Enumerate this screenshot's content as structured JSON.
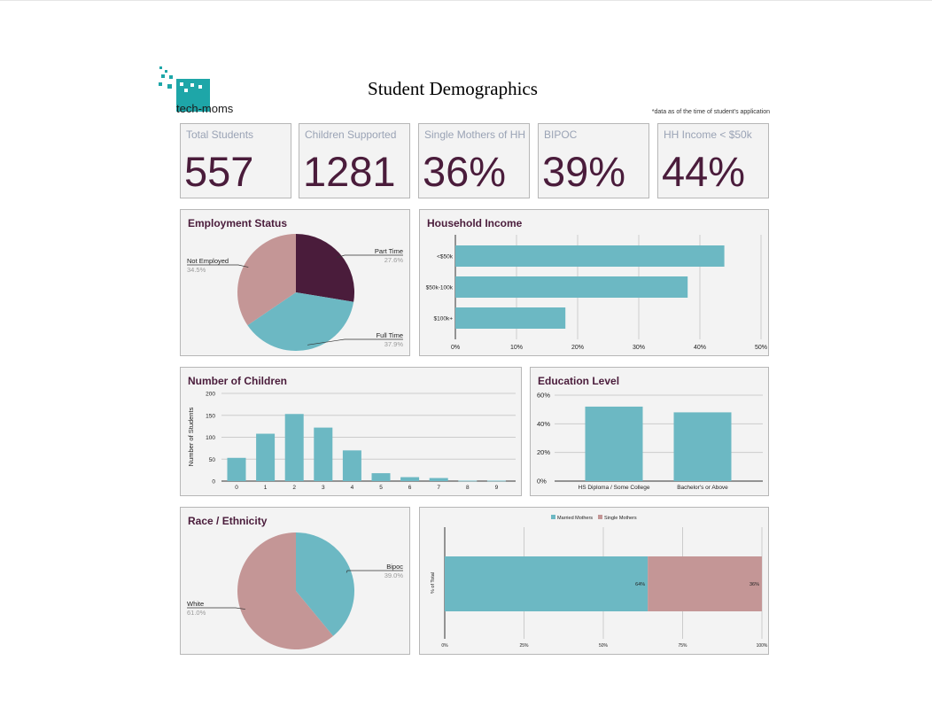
{
  "header": {
    "logo_text": "tech-moms",
    "title": "Student Demographics",
    "note": "*data as of the time of student's application"
  },
  "kpis": [
    {
      "label": "Total Students",
      "value": "557"
    },
    {
      "label": "Children Supported",
      "value": "1281"
    },
    {
      "label": "Single Mothers of HH",
      "value": "36%"
    },
    {
      "label": "BIPOC",
      "value": "39%"
    },
    {
      "label": "HH Income < $50k",
      "value": "44%"
    }
  ],
  "colors": {
    "dark": "#4a1c3b",
    "teal": "#6cb8c3",
    "rose": "#c49696",
    "panel": "#f3f3f3",
    "grid": "#cccccc"
  },
  "chart_data": [
    {
      "type": "pie",
      "title": "Employment Status",
      "slices": [
        {
          "label": "Part Time",
          "pct": "27.6%",
          "value": 27.6,
          "color": "#4a1c3b"
        },
        {
          "label": "Full Time",
          "pct": "37.9%",
          "value": 37.9,
          "color": "#6cb8c3"
        },
        {
          "label": "Not Employed",
          "pct": "34.5%",
          "value": 34.5,
          "color": "#c49696"
        }
      ]
    },
    {
      "type": "bar",
      "orientation": "horizontal",
      "title": "Household Income",
      "categories": [
        "<$50k",
        "$50k-100k",
        "$100k+"
      ],
      "values": [
        44,
        38,
        18
      ],
      "xticks": [
        "0%",
        "10%",
        "20%",
        "30%",
        "40%",
        "50%"
      ],
      "xlim": [
        0,
        50
      ]
    },
    {
      "type": "bar",
      "title": "Number of Children",
      "ylabel": "Number of Students",
      "categories": [
        "0",
        "1",
        "2",
        "3",
        "4",
        "5",
        "6",
        "7",
        "8",
        "9"
      ],
      "values": [
        53,
        108,
        153,
        122,
        70,
        18,
        9,
        7,
        1,
        1
      ],
      "yticks": [
        "0",
        "50",
        "100",
        "150",
        "200"
      ],
      "ylim": [
        0,
        200
      ]
    },
    {
      "type": "bar",
      "title": "Education Level",
      "categories": [
        "HS Diploma / Some College",
        "Bachelor's or Above"
      ],
      "values": [
        52,
        48
      ],
      "yticks": [
        "0%",
        "20%",
        "40%",
        "60%"
      ],
      "ylim": [
        0,
        60
      ]
    },
    {
      "type": "pie",
      "title": "Race / Ethnicity",
      "slices": [
        {
          "label": "Bipoc",
          "pct": "39.0%",
          "value": 39.0,
          "color": "#6cb8c3"
        },
        {
          "label": "White",
          "pct": "61.0%",
          "value": 61.0,
          "color": "#c49696"
        }
      ]
    },
    {
      "type": "bar",
      "orientation": "horizontal-stacked-100",
      "ylabel": "% of Total",
      "series": [
        {
          "name": "Married Mothers",
          "values": [
            64
          ],
          "label": "64%",
          "color": "#6cb8c3"
        },
        {
          "name": "Single Mothers",
          "values": [
            36
          ],
          "label": "36%",
          "color": "#c49696"
        }
      ],
      "xticks": [
        "0%",
        "25%",
        "50%",
        "75%",
        "100%"
      ],
      "xlim": [
        0,
        100
      ],
      "legend": "top"
    }
  ]
}
